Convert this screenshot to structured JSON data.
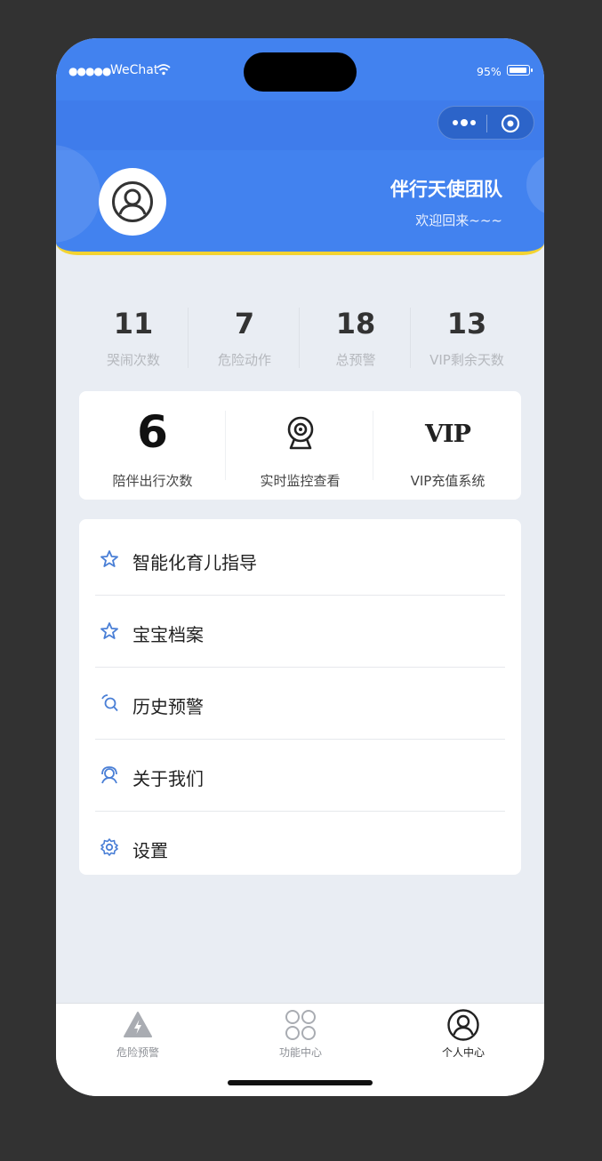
{
  "status_bar": {
    "signal": "●●●●●",
    "carrier": "WeChat",
    "battery": "95%"
  },
  "header": {
    "team_name": "伴行天使团队",
    "welcome": "欢迎回来~~~"
  },
  "stats": [
    {
      "value": "11",
      "label": "哭闹次数"
    },
    {
      "value": "7",
      "label": "危险动作"
    },
    {
      "value": "18",
      "label": "总预警"
    },
    {
      "value": "13",
      "label": "VIP剩余天数"
    }
  ],
  "quick": {
    "trips_value": "6",
    "trips_label": "陪伴出行次数",
    "monitor_icon": "camera-icon",
    "monitor_label": "实时监控查看",
    "vip_logo": "VIP",
    "vip_label": "VIP充值系统"
  },
  "menu": [
    {
      "label": "智能化育儿指导",
      "icon": "star-icon"
    },
    {
      "label": "宝宝档案",
      "icon": "star-icon"
    },
    {
      "label": "历史预警",
      "icon": "history-icon"
    },
    {
      "label": "关于我们",
      "icon": "team-icon"
    },
    {
      "label": "设置",
      "icon": "gear-icon"
    }
  ],
  "tabs": [
    {
      "label": "危险预警",
      "icon": "warning-icon",
      "active": false
    },
    {
      "label": "功能中心",
      "icon": "grid-icon",
      "active": false
    },
    {
      "label": "个人中心",
      "icon": "user-icon",
      "active": true
    }
  ],
  "colors": {
    "primary": "#4282ef",
    "accent_line": "#f3d331",
    "icon_blue": "#4a7fd6"
  }
}
